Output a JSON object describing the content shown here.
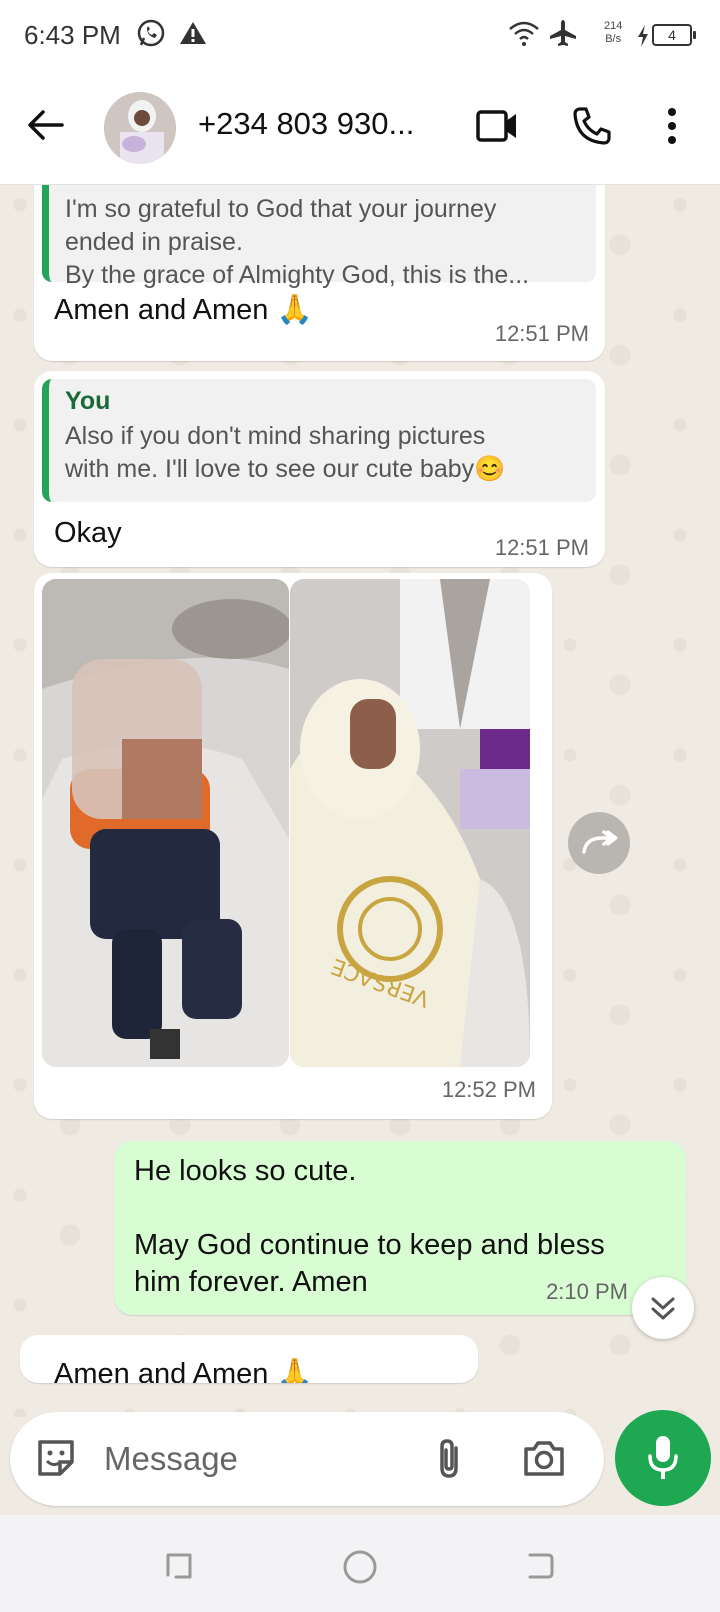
{
  "status_bar": {
    "time": "6:43 PM",
    "net_speed_value": "214",
    "net_speed_unit": "B/s",
    "battery": "4",
    "icons": [
      "whatsapp-icon",
      "warning-icon",
      "wifi-icon",
      "airplane-icon",
      "charging-icon",
      "battery-icon"
    ]
  },
  "header": {
    "contact_name": "+234 803 930...",
    "icons": [
      "back-arrow-icon",
      "video-call-icon",
      "phone-icon",
      "more-vert-icon"
    ]
  },
  "messages": [
    {
      "direction": "in",
      "quote_text_lines": [
        "I'm so grateful to God that your journey",
        "ended in praise.",
        "By the grace of Almighty God, this is the..."
      ],
      "text": "Amen and Amen 🙏",
      "time": "12:51 PM"
    },
    {
      "direction": "in",
      "quote_author": "You",
      "quote_text_lines": [
        "Also if you don't mind sharing pictures",
        "with me. I'll love to see our cute baby😊"
      ],
      "text": "Okay",
      "time": "12:51 PM"
    },
    {
      "direction": "in",
      "type": "photos",
      "photo_count": 2,
      "photo_print": "VERSACE",
      "time": "12:52 PM"
    },
    {
      "direction": "out",
      "text_lines": [
        "He looks so cute.",
        "",
        "May God continue to keep and bless",
        "him forever. Amen"
      ],
      "time": "2:10 PM"
    },
    {
      "direction": "in",
      "text": "Amen and Amen 🙏",
      "partially_hidden": true
    }
  ],
  "composer": {
    "placeholder": "Message",
    "icons": [
      "sticker-icon",
      "attach-icon",
      "camera-icon",
      "mic-icon"
    ]
  },
  "colors": {
    "accent_green": "#1da851",
    "outgoing_bubble": "#d9fdd3",
    "chat_background": "#efeae2",
    "quote_bar": "#25a35a"
  }
}
